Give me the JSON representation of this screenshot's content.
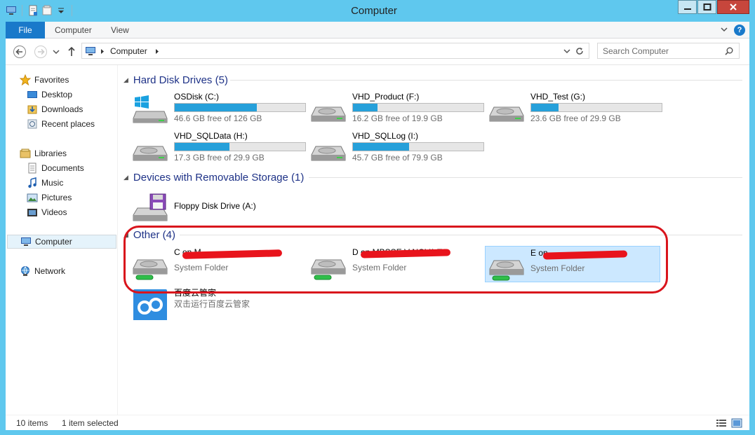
{
  "window": {
    "title": "Computer"
  },
  "ribbon": {
    "tabs": [
      "File",
      "Computer",
      "View"
    ]
  },
  "address": {
    "path": "Computer"
  },
  "search": {
    "placeholder": "Search Computer"
  },
  "nav": {
    "favorites": "Favorites",
    "desktop": "Desktop",
    "downloads": "Downloads",
    "recent": "Recent places",
    "libraries": "Libraries",
    "documents": "Documents",
    "music": "Music",
    "pictures": "Pictures",
    "videos": "Videos",
    "computer": "Computer",
    "network": "Network"
  },
  "groups": {
    "hdd": "Hard Disk Drives (5)",
    "removable": "Devices with Removable Storage (1)",
    "other": "Other (4)"
  },
  "drives": [
    {
      "name": "OSDisk (C:)",
      "free": "46.6 GB free of 126 GB",
      "used_fraction": 0.63
    },
    {
      "name": "VHD_Product (F:)",
      "free": "16.2 GB free of 19.9 GB",
      "used_fraction": 0.19
    },
    {
      "name": "VHD_Test (G:)",
      "free": "23.6 GB free of 29.9 GB",
      "used_fraction": 0.21
    },
    {
      "name": "VHD_SQLData (H:)",
      "free": "17.3 GB free of 29.9 GB",
      "used_fraction": 0.42
    },
    {
      "name": "VHD_SQLLog (I:)",
      "free": "45.7 GB free of 79.9 GB",
      "used_fraction": 0.43
    }
  ],
  "removable": [
    {
      "name": "Floppy Disk Drive (A:)"
    }
  ],
  "other": [
    {
      "name": "C on M",
      "sub": "System Folder"
    },
    {
      "name": "D on MBSSE V NOVA TS",
      "sub": "System Folder"
    },
    {
      "name": "E on",
      "sub": "System Folder"
    },
    {
      "name": "百度云管家",
      "sub": "双击运行百度云管家"
    }
  ],
  "status": {
    "items": "10 items",
    "selected": "1 item selected"
  },
  "colors": {
    "accent": "#1979ca",
    "bar": "#26a0da",
    "annotation": "#d9141c",
    "frame": "#5fc8ee"
  }
}
